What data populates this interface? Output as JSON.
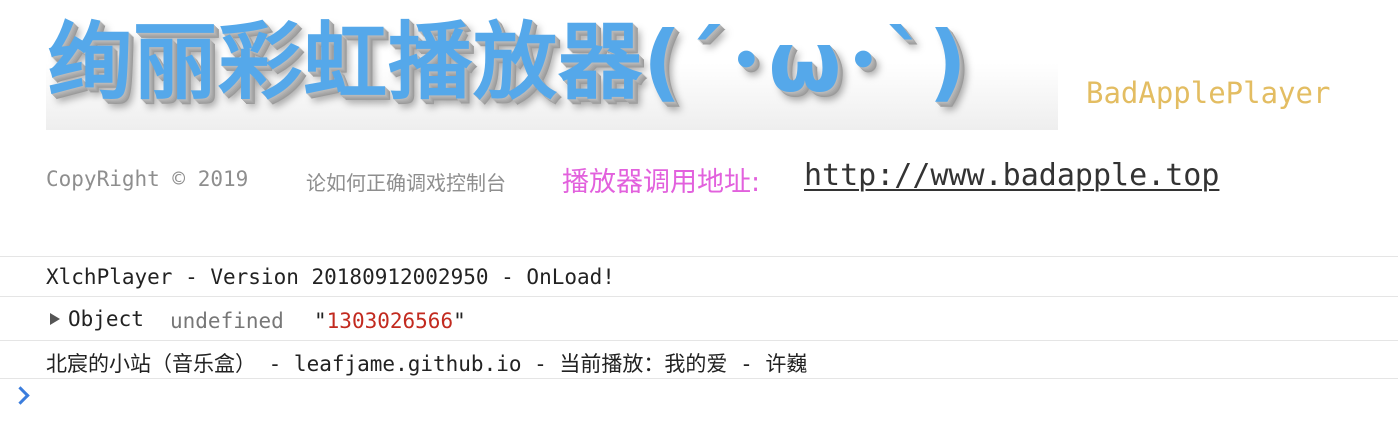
{
  "banner": {
    "title": "绚丽彩虹播放器(´･ω･`)",
    "subtitle": "BadApplePlayer",
    "title_color": "#55a8ea",
    "subtitle_color": "#e3bd62"
  },
  "info_line": {
    "copyright": "CopyRight © 2019",
    "console_tip": "论如何正确调戏控制台",
    "player_label": "播放器调用地址:",
    "player_url": "http://www.badapple.top",
    "player_label_color": "#e261dd"
  },
  "console": {
    "log1": "XlchPlayer - Version 20180912002950 - OnLoad!",
    "log2": {
      "icon": "expand-triangle-icon",
      "object_label": "Object",
      "undefined_label": "undefined",
      "quote_open": "\"",
      "number_value": "1303026566",
      "quote_close": "\"",
      "number_color": "#c22a1f"
    },
    "log3": "北宸的小站（音乐盒） - leafjame.github.io - 当前播放：我的爱 - 许巍",
    "prompt_icon": "chevron-right-icon",
    "prompt_value": ""
  }
}
